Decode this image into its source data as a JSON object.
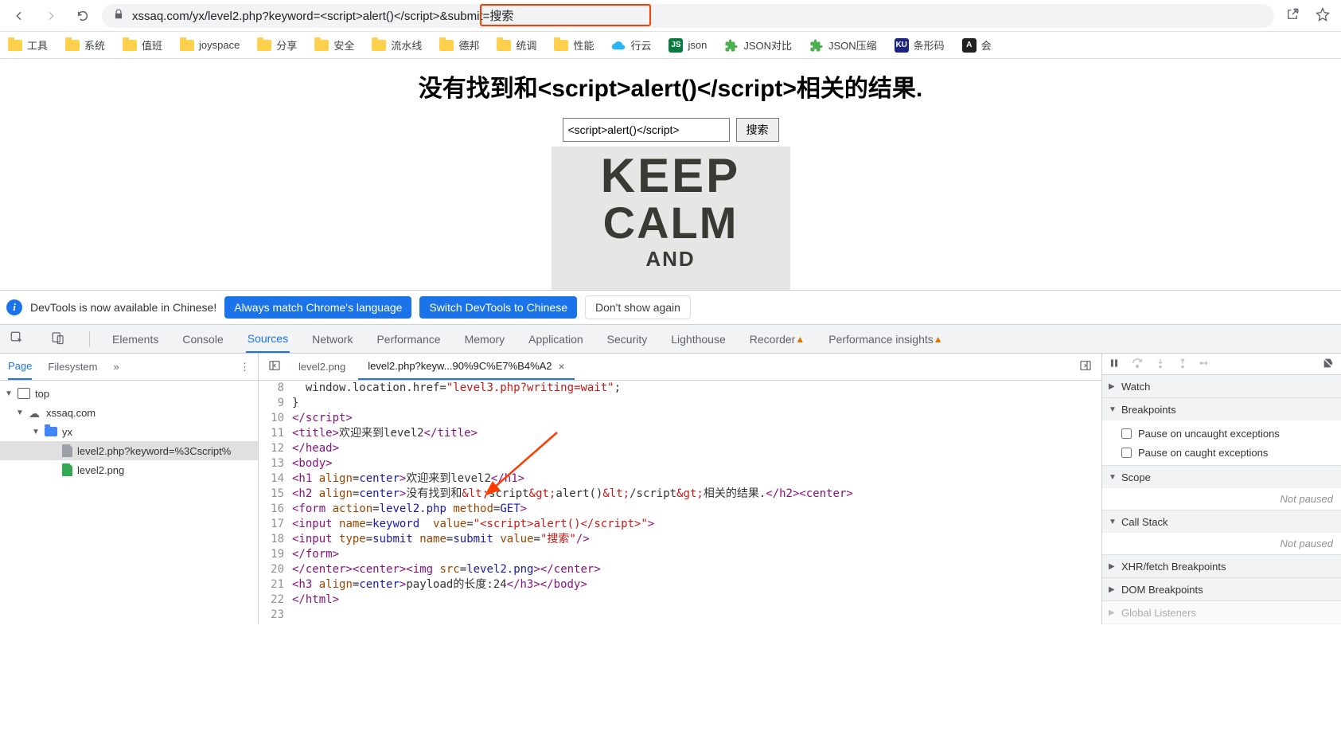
{
  "browser": {
    "url_pre": "xssaq.com/yx/level2.php?keyword=",
    "url_highlighted": "<script>alert()</script>",
    "url_post": "&submit=搜索",
    "bookmarks": [
      {
        "label": "工具",
        "icon": "folder"
      },
      {
        "label": "系统",
        "icon": "folder"
      },
      {
        "label": "值班",
        "icon": "folder"
      },
      {
        "label": "joyspace",
        "icon": "folder"
      },
      {
        "label": "分享",
        "icon": "folder"
      },
      {
        "label": "安全",
        "icon": "folder"
      },
      {
        "label": "流水线",
        "icon": "folder"
      },
      {
        "label": "德邦",
        "icon": "folder"
      },
      {
        "label": "统调",
        "icon": "folder"
      },
      {
        "label": "性能",
        "icon": "folder"
      },
      {
        "label": "行云",
        "icon": "cloud"
      },
      {
        "label": "json",
        "icon": "json"
      },
      {
        "label": "JSON对比",
        "icon": "jsoncmp"
      },
      {
        "label": "JSON压缩",
        "icon": "jsoncmp"
      },
      {
        "label": "条形码",
        "icon": "ku"
      },
      {
        "label": "会",
        "icon": "a"
      }
    ]
  },
  "page": {
    "heading": "没有找到和<script>alert()</script>相关的结果.",
    "input_value": "<script>alert()</script>",
    "submit_label": "搜索",
    "poster": {
      "l1": "KEEP",
      "l2": "CALM",
      "l3": "AND"
    }
  },
  "devtools": {
    "notice": {
      "message": "DevTools is now available in Chinese!",
      "btn_always": "Always match Chrome's language",
      "btn_switch": "Switch DevTools to Chinese",
      "btn_dont": "Don't show again"
    },
    "tabs": [
      "Elements",
      "Console",
      "Sources",
      "Network",
      "Performance",
      "Memory",
      "Application",
      "Security",
      "Lighthouse"
    ],
    "tab_recorder": "Recorder",
    "tab_perf_insights": "Performance insights",
    "active_tab": "Sources",
    "left": {
      "tabs": [
        "Page",
        "Filesystem"
      ],
      "active": "Page",
      "tree": {
        "top": "top",
        "domain": "xssaq.com",
        "folder": "yx",
        "file_php": "level2.php?keyword=%3Cscript%",
        "file_png": "level2.png"
      }
    },
    "center": {
      "tab_png": "level2.png",
      "tab_php": "level2.php?keyw...90%9C%E7%B4%A2",
      "code": [
        {
          "n": 8,
          "html": "  window.location.href=<span class='tok-str'>\"level3.php?writing=wait\"</span>;"
        },
        {
          "n": 9,
          "html": "}"
        },
        {
          "n": 10,
          "html": "<span class='tok-tag'>&lt;/script&gt;</span>"
        },
        {
          "n": 11,
          "html": "<span class='tok-tag'>&lt;title&gt;</span>欢迎来到level2<span class='tok-tag'>&lt;/title&gt;</span>"
        },
        {
          "n": 12,
          "html": "<span class='tok-tag'>&lt;/head&gt;</span>"
        },
        {
          "n": 13,
          "html": "<span class='tok-tag'>&lt;body&gt;</span>"
        },
        {
          "n": 14,
          "html": "<span class='tok-tag'>&lt;h1</span> <span class='tok-attr'>align</span>=<span class='tok-val'>center</span><span class='tok-tag'>&gt;</span>欢迎来到level2<span class='tok-tag'>&lt;/h1&gt;</span>"
        },
        {
          "n": 15,
          "html": "<span class='tok-tag'>&lt;h2</span> <span class='tok-attr'>align</span>=<span class='tok-val'>center</span><span class='tok-tag'>&gt;</span>没有找到和<span class='tok-str'>&amp;lt;</span>script<span class='tok-str'>&amp;gt;</span>alert()<span class='tok-str'>&amp;lt;</span>/script<span class='tok-str'>&amp;gt;</span>相关的结果.<span class='tok-tag'>&lt;/h2&gt;&lt;center&gt;</span>"
        },
        {
          "n": 16,
          "html": "<span class='tok-tag'>&lt;form</span> <span class='tok-attr'>action</span>=<span class='tok-val'>level2.php</span> <span class='tok-attr'>method</span>=<span class='tok-val'>GET</span><span class='tok-tag'>&gt;</span>"
        },
        {
          "n": 17,
          "html": "<span class='tok-tag'>&lt;input</span> <span class='tok-attr'>name</span>=<span class='tok-val'>keyword</span>  <span class='tok-attr'>value</span>=<span class='tok-str'>\"&lt;script&gt;alert()&lt;/script&gt;\"</span><span class='tok-tag'>&gt;</span>"
        },
        {
          "n": 18,
          "html": "<span class='tok-tag'>&lt;input</span> <span class='tok-attr'>type</span>=<span class='tok-val'>submit</span> <span class='tok-attr'>name</span>=<span class='tok-val'>submit</span> <span class='tok-attr'>value</span>=<span class='tok-str'>\"搜索\"</span><span class='tok-tag'>/&gt;</span>"
        },
        {
          "n": 19,
          "html": "<span class='tok-tag'>&lt;/form&gt;</span>"
        },
        {
          "n": 20,
          "html": "<span class='tok-tag'>&lt;/center&gt;&lt;center&gt;&lt;img</span> <span class='tok-attr'>src</span>=<span class='tok-val'>level2.png</span><span class='tok-tag'>&gt;&lt;/center&gt;</span>"
        },
        {
          "n": 21,
          "html": "<span class='tok-tag'>&lt;h3</span> <span class='tok-attr'>align</span>=<span class='tok-val'>center</span><span class='tok-tag'>&gt;</span>payload的长度:24<span class='tok-tag'>&lt;/h3&gt;&lt;/body&gt;</span>"
        },
        {
          "n": 22,
          "html": "<span class='tok-tag'>&lt;/html&gt;</span>"
        },
        {
          "n": 23,
          "html": ""
        }
      ]
    },
    "right": {
      "watch": "Watch",
      "breakpoints": "Breakpoints",
      "bp_uncaught": "Pause on uncaught exceptions",
      "bp_caught": "Pause on caught exceptions",
      "scope": "Scope",
      "callstack": "Call Stack",
      "xhr": "XHR/fetch Breakpoints",
      "dom": "DOM Breakpoints",
      "global": "Global Listeners",
      "not_paused": "Not paused"
    }
  }
}
